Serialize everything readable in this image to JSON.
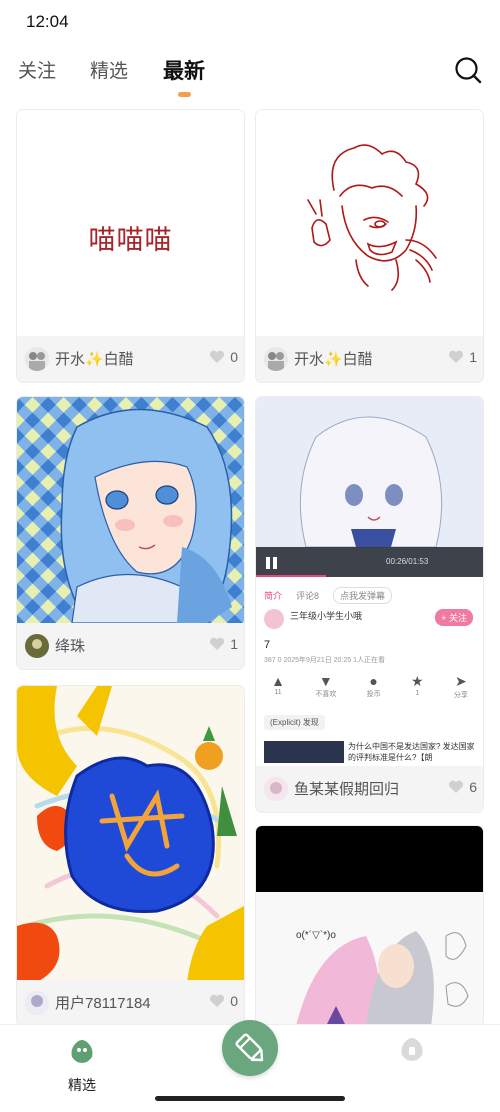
{
  "status_bar": {
    "time": "12:04"
  },
  "header": {
    "tabs": [
      {
        "label": "关注",
        "active": false
      },
      {
        "label": "精选",
        "active": false
      },
      {
        "label": "最新",
        "active": true
      }
    ],
    "search_icon": "search-icon",
    "accent": "#f0a050"
  },
  "feed": {
    "cards": [
      {
        "image_text": "喵喵喵",
        "image_text_color": "#a6262a",
        "author": "开水✨白醋",
        "likes": "0"
      },
      {
        "image_desc": "red sketch drawing",
        "author": "开水✨白醋",
        "likes": "1"
      },
      {
        "image_desc": "blue hair portrait",
        "author": "绛珠",
        "likes": "1"
      },
      {
        "image_desc": "video screenshot",
        "author": "鱼某某假期回归",
        "likes": "6",
        "embedded": {
          "video_time": "00:26/01:53",
          "tabs": [
            "简介",
            "评论8",
            "点我发弹幕"
          ],
          "uploader": "三年级小学生小哦",
          "follow_label": "+ 关注",
          "title": "7",
          "meta": "387 0 2025年9月21日 20:25 1人正在看",
          "actions": [
            "11",
            "不喜欢",
            "投币",
            "1",
            "分享"
          ],
          "tag_row": "(Explicit)  发现",
          "rec_title": "为什么中国不是发达国家? 发达国家的评判标准是什么?【朗"
        }
      },
      {
        "image_desc": "colorful doodle",
        "author": "用户78117184",
        "likes": "0"
      },
      {
        "image_desc": "anime pair drawing",
        "author": "",
        "likes": ""
      }
    ]
  },
  "bottom_nav": {
    "items": [
      {
        "label": "精选",
        "icon": "bag-icon"
      },
      {
        "label": "",
        "icon": "gray-bag-icon"
      }
    ],
    "fab_icon": "pencil-icon",
    "fab_color": "#6aa77f"
  }
}
